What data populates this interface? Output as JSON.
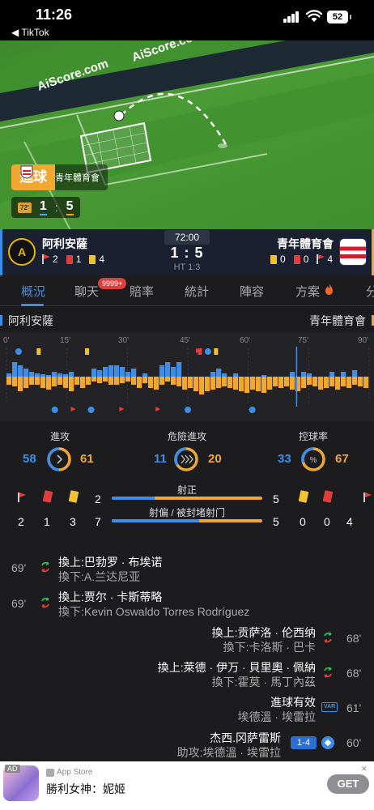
{
  "status_bar": {
    "time": "11:26",
    "back_app": "◀ TikTok",
    "battery": "52"
  },
  "pitch": {
    "ads": [
      "AiScore.com",
      "AiScore.com"
    ],
    "goal_banner": {
      "label": "進球",
      "team": "青年體育會"
    },
    "mini_score": {
      "minute_tag": "72'",
      "home": "1",
      "away": "5"
    }
  },
  "match": {
    "home": {
      "name": "阿利安薩",
      "corners": "2",
      "red": "1",
      "yellow": "4"
    },
    "away": {
      "name": "青年體育會",
      "yellow": "0",
      "red": "0",
      "corners": "4"
    },
    "time": "72:00",
    "score": "1 : 5",
    "half_time": "HT 1:3"
  },
  "tabs": [
    {
      "label": "概況",
      "active": true
    },
    {
      "label": "聊天",
      "active": false
    },
    {
      "label": "賠率",
      "active": false
    },
    {
      "label": "統計",
      "active": false
    },
    {
      "label": "陣容",
      "active": false
    },
    {
      "label": "方案",
      "active": false
    },
    {
      "label": "分",
      "active": false
    }
  ],
  "chat_badge": "9999+",
  "strip": {
    "home": "阿利安薩",
    "away": "青年體育會"
  },
  "momentum": {
    "minutes": [
      "0'",
      "15'",
      "30'",
      "45'",
      "60'",
      "75'",
      "90'"
    ],
    "current_minute": 72,
    "home_bars": [
      4,
      18,
      14,
      10,
      6,
      4,
      3,
      2,
      6,
      4,
      3,
      6,
      0,
      0,
      0,
      10,
      8,
      12,
      14,
      14,
      12,
      6,
      10,
      0,
      4,
      0,
      0,
      14,
      18,
      12,
      18,
      0,
      0,
      0,
      0,
      0,
      6,
      10,
      4,
      0,
      4,
      0,
      0,
      0,
      0,
      2,
      0,
      0,
      0,
      0,
      6,
      0,
      6,
      4,
      0,
      0,
      0,
      6,
      0,
      6,
      0,
      8,
      0,
      0
    ],
    "away_bars": [
      10,
      12,
      18,
      14,
      10,
      10,
      14,
      16,
      12,
      10,
      14,
      18,
      10,
      14,
      10,
      6,
      8,
      6,
      10,
      10,
      8,
      6,
      10,
      14,
      8,
      14,
      16,
      10,
      6,
      10,
      12,
      16,
      14,
      18,
      22,
      18,
      16,
      14,
      12,
      14,
      16,
      18,
      20,
      16,
      18,
      20,
      16,
      12,
      14,
      12,
      16,
      18,
      14,
      10,
      12,
      16,
      14,
      12,
      16,
      12,
      14,
      10,
      12,
      14
    ]
  },
  "stats": {
    "attack": {
      "title": "進攻",
      "home": "58",
      "away": "61"
    },
    "dangerous": {
      "title": "危險進攻",
      "home": "11",
      "away": "20"
    },
    "possession": {
      "title": "控球率",
      "home": "33",
      "away": "67"
    },
    "home_icons_counts": [
      "2",
      "1",
      "3"
    ],
    "away_icons_counts": [
      "0",
      "0",
      "4"
    ],
    "shots_on": {
      "label": "射正",
      "home": "2",
      "away": "5",
      "home_frac": 0.286
    },
    "shots_off": {
      "label": "射偏 / 被封堵射门",
      "home": "7",
      "away": "5",
      "home_frac": 0.583
    }
  },
  "events": [
    {
      "minute": "69'",
      "side": "home",
      "line1": "換上:巴勃罗 · 布埃诺",
      "line2": "換下:A.兰达尼亚"
    },
    {
      "minute": "69'",
      "side": "home",
      "line1": "換上:贾尔 · 卡斯蒂略",
      "line2": "換下:Kevin Oswaldo Torres Rodríguez"
    },
    {
      "minute": "68'",
      "side": "away",
      "line1": "換上:贡萨洛 · 伦西纳",
      "line2": "換下:卡洛斯 · 巴卡"
    },
    {
      "minute": "68'",
      "side": "away",
      "line1": "換上:萊德 · 伊万 · 貝里奧 · 佩納",
      "line2": "換下:霍莫 · 馬丁內茲"
    },
    {
      "minute": "61'",
      "side": "away",
      "line1": "進球有效",
      "line2": "埃德溫 · 埃雷拉"
    },
    {
      "minute": "60'",
      "side": "away",
      "line1": "杰西.冈萨雷斯",
      "line2": "助攻:埃德溫 · 埃雷拉",
      "score": "1-4"
    }
  ],
  "var_label": "VAR",
  "ad": {
    "tag": "AD",
    "store": "App Store",
    "title": "勝利女神：妮姬",
    "button": "GET",
    "close": "✕"
  },
  "colors": {
    "home": "#3d8ee8",
    "away": "#f0a830",
    "accent": "#3d8ee8"
  }
}
